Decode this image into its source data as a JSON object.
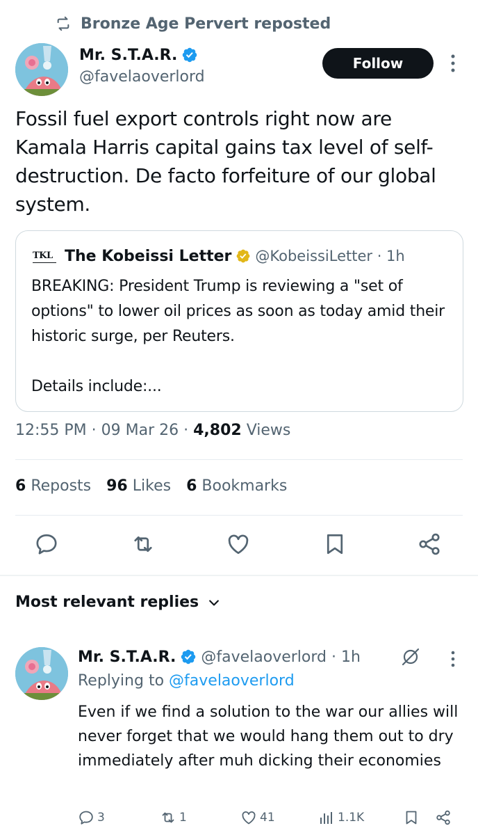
{
  "repost_banner": {
    "text": "Bronze Age Pervert reposted",
    "icon": "repost-icon"
  },
  "tweet": {
    "author_name": "Mr. S.T.A.R.",
    "author_handle": "@favelaoverlord",
    "verified": true,
    "follow_label": "Follow",
    "text": "Fossil fuel export controls right now are Kamala Harris capital gains tax level of self-destruction. De facto forfeiture of our global system.",
    "quote": {
      "logo_text": "TKL",
      "name": "The Kobeissi Letter",
      "handle_time": "@KobeissiLetter · 1h",
      "body": "BREAKING: President Trump is reviewing a \"set of options\" to lower oil prices as soon as today amid their historic surge, per Reuters.",
      "details": "Details include:..."
    },
    "time": "12:55 PM",
    "date": "09 Mar 26",
    "views_count": "4,802",
    "views_label": "Views",
    "sep": " · "
  },
  "stats": {
    "reposts_count": "6",
    "reposts_label": "Reposts",
    "likes_count": "96",
    "likes_label": "Likes",
    "bookmarks_count": "6",
    "bookmarks_label": "Bookmarks"
  },
  "replies_section": {
    "title": "Most relevant replies"
  },
  "reply": {
    "author_name": "Mr. S.T.A.R.",
    "meta": "@favelaoverlord · 1h",
    "replying_prefix": "Replying to ",
    "replying_to": "@favelaoverlord",
    "text": "Even if we find a solution to the war our allies will never forget that we would hang them out to dry immediately after muh dicking their economies",
    "replies": "3",
    "reposts": "1",
    "likes": "41",
    "views": "1.1K"
  },
  "colors": {
    "text": "#0f1419",
    "secondary": "#536471",
    "link": "#1d9bf0",
    "verified": "#1d9bf0",
    "gold_badge": "#e2b719",
    "border": "#cfd9de"
  }
}
